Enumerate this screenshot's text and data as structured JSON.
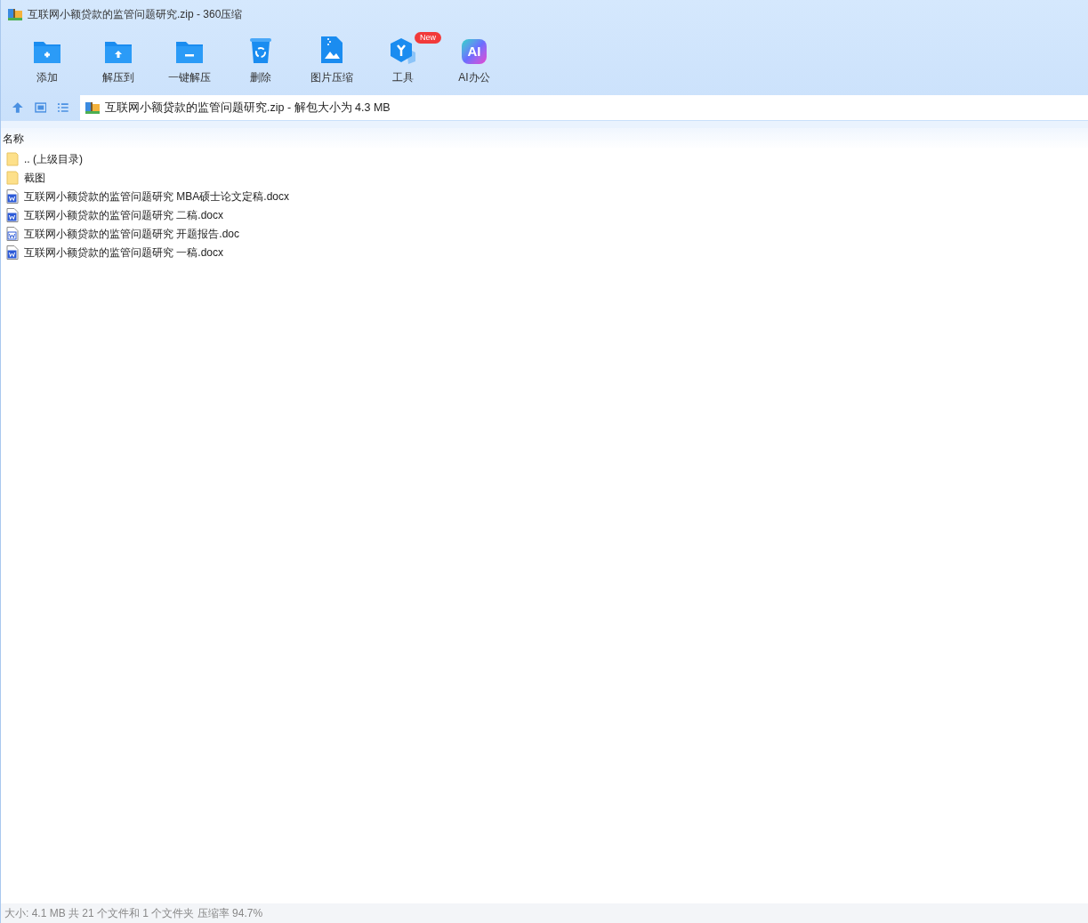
{
  "window": {
    "title": "互联网小额贷款的监管问题研究.zip - 360压缩"
  },
  "toolbar": [
    {
      "kind": "add",
      "label": "添加"
    },
    {
      "kind": "extract",
      "label": "解压到"
    },
    {
      "kind": "oneclick",
      "label": "一键解压"
    },
    {
      "kind": "delete",
      "label": "删除"
    },
    {
      "kind": "image",
      "label": "图片压缩"
    },
    {
      "kind": "tools",
      "label": "工具",
      "badge": "New"
    },
    {
      "kind": "ai",
      "label": "AI办公",
      "icon_text": "AI"
    }
  ],
  "address": {
    "path": "互联网小额贷款的监管问题研究.zip - 解包大小为 4.3 MB"
  },
  "table": {
    "columns": [
      "名称"
    ],
    "rows": [
      {
        "kind": "folder",
        "name": ".. (上级目录)"
      },
      {
        "kind": "folder",
        "name": "截图"
      },
      {
        "kind": "docx",
        "name": "互联网小额贷款的监管问题研究 MBA硕士论文定稿.docx"
      },
      {
        "kind": "docx",
        "name": "互联网小额贷款的监管问题研究 二稿.docx"
      },
      {
        "kind": "doc",
        "name": "互联网小额贷款的监管问题研究 开题报告.doc"
      },
      {
        "kind": "docx",
        "name": "互联网小额贷款的监管问题研究 一稿.docx"
      }
    ]
  },
  "status_bar": "大小: 4.1 MB 共 21 个文件和 1 个文件夹 压缩率 94.7%"
}
